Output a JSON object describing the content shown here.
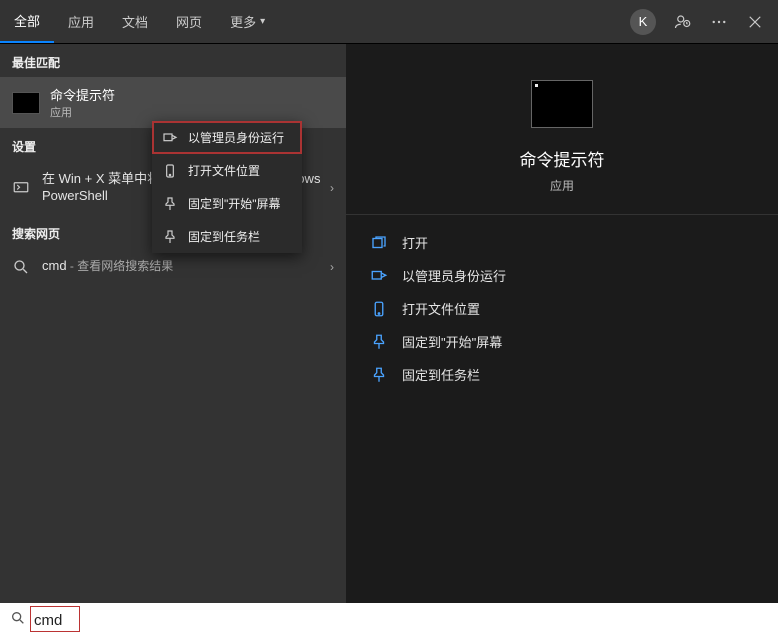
{
  "header": {
    "tabs": [
      {
        "label": "全部",
        "active": true
      },
      {
        "label": "应用",
        "active": false
      },
      {
        "label": "文档",
        "active": false
      },
      {
        "label": "网页",
        "active": false
      },
      {
        "label": "更多",
        "active": false,
        "dropdown": true
      }
    ],
    "avatar_letter": "K"
  },
  "left": {
    "best_match_header": "最佳匹配",
    "best_match": {
      "title": "命令提示符",
      "subtitle": "应用"
    },
    "settings_header": "设置",
    "settings_item": {
      "text": "在 Win + X 菜单中将命令提示符替换为 Windows PowerShell"
    },
    "web_header": "搜索网页",
    "web_item": {
      "query": "cmd",
      "suffix": " - 查看网络搜索结果"
    }
  },
  "context_menu": {
    "items": [
      {
        "label": "以管理员身份运行",
        "icon": "run-admin-icon",
        "highlight": true
      },
      {
        "label": "打开文件位置",
        "icon": "open-location-icon"
      },
      {
        "label": "固定到\"开始\"屏幕",
        "icon": "pin-start-icon"
      },
      {
        "label": "固定到任务栏",
        "icon": "pin-taskbar-icon"
      }
    ]
  },
  "preview": {
    "title": "命令提示符",
    "subtitle": "应用",
    "actions": [
      {
        "label": "打开",
        "icon": "open-icon"
      },
      {
        "label": "以管理员身份运行",
        "icon": "run-admin-icon"
      },
      {
        "label": "打开文件位置",
        "icon": "open-location-icon"
      },
      {
        "label": "固定到\"开始\"屏幕",
        "icon": "pin-start-icon"
      },
      {
        "label": "固定到任务栏",
        "icon": "pin-taskbar-icon"
      }
    ]
  },
  "search": {
    "value": "cmd"
  }
}
